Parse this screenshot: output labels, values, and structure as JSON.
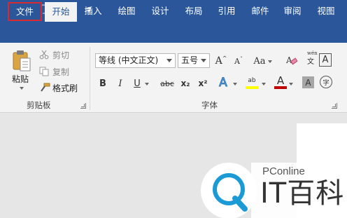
{
  "quick_access": {
    "save_icon": "save-icon",
    "undo_icon": "undo-icon",
    "redo_icon": "redo-icon",
    "customize_icon": "customize-quick-access-icon"
  },
  "tabs": [
    {
      "label": "文件"
    },
    {
      "label": "开始"
    },
    {
      "label": "插入"
    },
    {
      "label": "绘图"
    },
    {
      "label": "设计"
    },
    {
      "label": "布局"
    },
    {
      "label": "引用"
    },
    {
      "label": "邮件"
    },
    {
      "label": "审阅"
    },
    {
      "label": "视图"
    }
  ],
  "clipboard": {
    "paste_label": "粘贴",
    "cut_label": "剪切",
    "copy_label": "复制",
    "format_painter_label": "格式刷",
    "group_label": "剪贴板"
  },
  "font": {
    "font_name": "等线 (中文正文)",
    "font_size": "五号",
    "grow_label": "A",
    "shrink_label": "A",
    "change_case_label": "Aa",
    "bold_label": "B",
    "italic_label": "I",
    "underline_label": "U",
    "strike_label": "abc",
    "subscript_label": "x₂",
    "superscript_label": "x²",
    "text_effect_label": "A",
    "highlight_label": "ab",
    "font_color_label": "A",
    "char_shading_label": "A",
    "enclose_label": "字",
    "phonetic_label": "文",
    "border_label": "A",
    "group_label": "字体"
  },
  "watermark": {
    "sub": "PConline",
    "main": "IT百科"
  },
  "colors": {
    "ribbon_blue": "#2b579a",
    "file_highlight": "#d9282f",
    "font_color_bar": "#c00000",
    "highlight_bar": "#ffff00"
  }
}
